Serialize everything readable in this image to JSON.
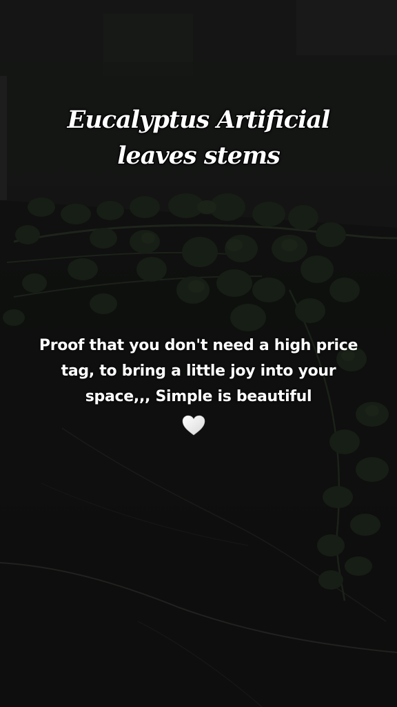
{
  "story": {
    "title": "Eucalyptus Artificial leaves stems",
    "caption": "Proof that you don't need a high price tag, to bring a little joy into your space,,, Simple is beautiful",
    "heart_icon": "white-heart-icon"
  },
  "colors": {
    "text": "#ffffff",
    "leaf": "#1f2a1d",
    "background": "#141414"
  }
}
